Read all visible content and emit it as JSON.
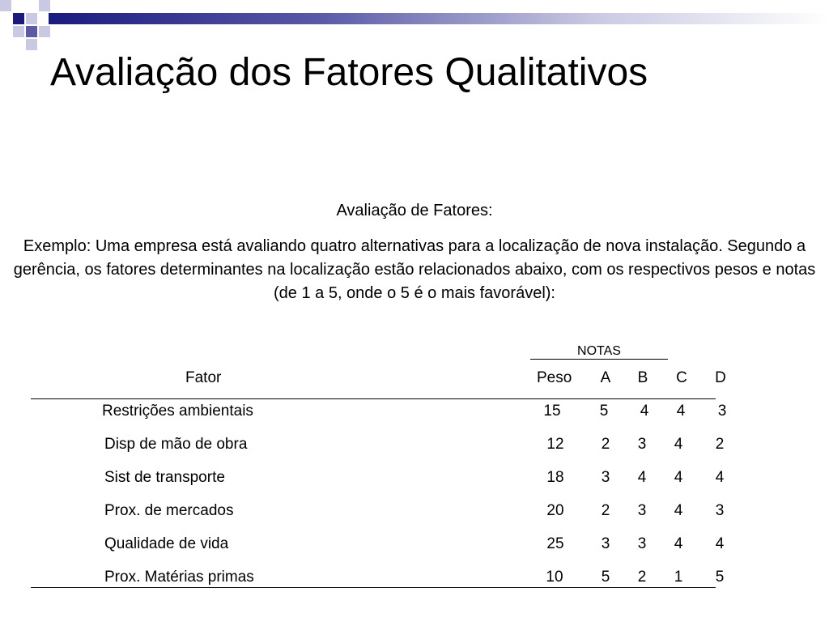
{
  "slide": {
    "title": "Avaliação dos Fatores Qualitativos",
    "subtitle": "Avaliação de Fatores:",
    "paragraph": "Exemplo: Uma empresa está avaliando quatro  alternativas para a localização de nova instalação. Segundo a gerência, os fatores determinantes na localização estão relacionados abaixo, com os respectivos pesos e notas (de 1 a 5, onde o 5 é o mais favorável):"
  },
  "table": {
    "group_label": "NOTAS",
    "headers": {
      "fator": "Fator",
      "peso": "Peso",
      "a": "A",
      "b": "B",
      "c": "C",
      "d": "D"
    },
    "rows": [
      {
        "fator": "Restrições ambientais",
        "peso": "15",
        "a": "5",
        "b": "4",
        "c": "4",
        "d": "3"
      },
      {
        "fator": "Disp de mão de obra",
        "peso": "12",
        "a": "2",
        "b": "3",
        "c": "4",
        "d": "2"
      },
      {
        "fator": "Sist de transporte",
        "peso": "18",
        "a": "3",
        "b": "4",
        "c": "4",
        "d": "4"
      },
      {
        "fator": "Prox. de mercados",
        "peso": "20",
        "a": "2",
        "b": "3",
        "c": "4",
        "d": "3"
      },
      {
        "fator": "Qualidade de vida",
        "peso": "25",
        "a": "3",
        "b": "3",
        "c": "4",
        "d": "4"
      },
      {
        "fator": "Prox. Matérias primas",
        "peso": "10",
        "a": "5",
        "b": "2",
        "c": "1",
        "d": "5"
      }
    ]
  },
  "colors": {
    "accent_dark": "#1a1a80",
    "accent_mid": "#5a5aa8",
    "accent_light": "#c9c9e3"
  }
}
